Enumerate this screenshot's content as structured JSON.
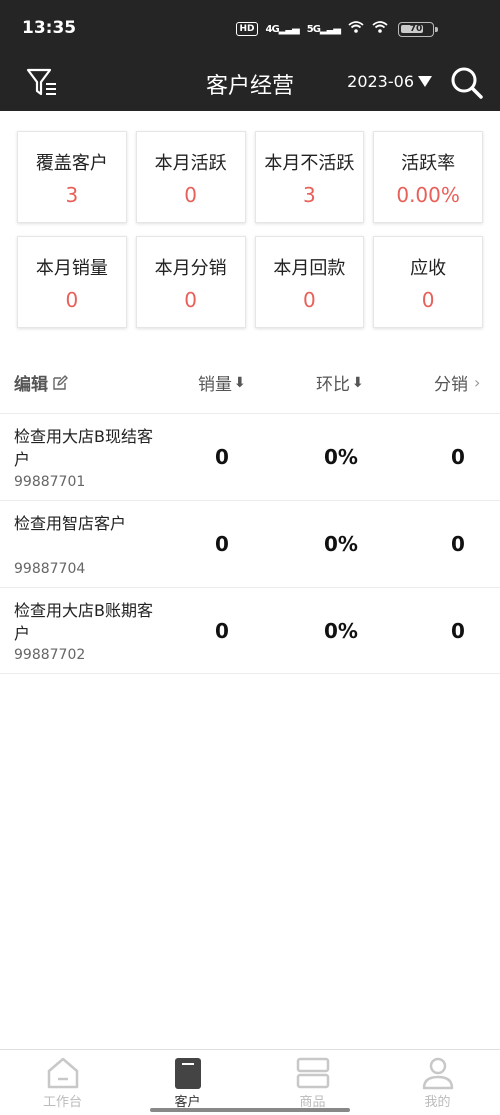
{
  "status": {
    "time": "13:35",
    "hd": "HD",
    "net1": "4G",
    "net2": "5G",
    "battery": "70"
  },
  "header": {
    "title": "客户经营",
    "month": "2023-06"
  },
  "stats": [
    {
      "label": "覆盖客户",
      "value": "3"
    },
    {
      "label": "本月活跃",
      "value": "0"
    },
    {
      "label": "本月不活跃",
      "value": "3"
    },
    {
      "label": "活跃率",
      "value": "0.00%"
    },
    {
      "label": "本月销量",
      "value": "0"
    },
    {
      "label": "本月分销",
      "value": "0"
    },
    {
      "label": "本月回款",
      "value": "0"
    },
    {
      "label": "应收",
      "value": "0"
    }
  ],
  "table": {
    "edit_label": "编辑",
    "columns": [
      "销量",
      "环比",
      "分销"
    ],
    "rows": [
      {
        "name": "检查用大店B现结客户",
        "code": "99887701",
        "sales": "0",
        "mom": "0%",
        "dist": "0"
      },
      {
        "name": "检查用智店客户",
        "code": "99887704",
        "sales": "0",
        "mom": "0%",
        "dist": "0"
      },
      {
        "name": "检查用大店B账期客户",
        "code": "99887702",
        "sales": "0",
        "mom": "0%",
        "dist": "0"
      }
    ]
  },
  "nav": [
    {
      "label": "工作台",
      "icon": "home-icon"
    },
    {
      "label": "客户",
      "icon": "customer-icon"
    },
    {
      "label": "商品",
      "icon": "goods-icon"
    },
    {
      "label": "我的",
      "icon": "profile-icon"
    }
  ],
  "colors": {
    "header_bg": "#252525",
    "accent_red": "#e8605a"
  }
}
